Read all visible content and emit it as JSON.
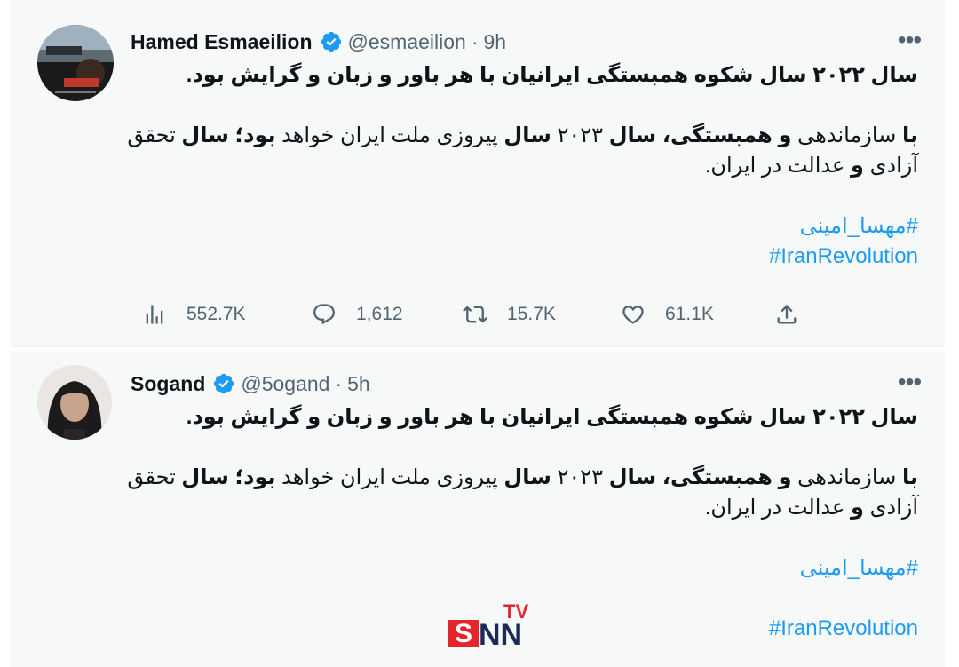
{
  "tweets": [
    {
      "name": "Hamed Esmaeilion",
      "handle": "@esmaeilion",
      "separator": "·",
      "time": "9h",
      "line1": "سال ۲۰۲۲ سال شکوه همبستگی ایرانیان با هر باور و زبان و گرایش بود.",
      "p2": {
        "w1": "با",
        "t1": " سازماندهی ",
        "w2": "و همبستگی،",
        "t2": " ",
        "w3": "سال",
        "t3": " ۲۰۲۳ ",
        "w4": "سال",
        "t4": " پیروزی ملت ایران خواهد ",
        "w5": "بود؛ سال",
        "t5": " تحقق"
      },
      "p3": {
        "t1": "آزادی ",
        "w1": "و",
        "t2": " عدالت در ایران."
      },
      "hashtag1": "#مهسا_امینی",
      "hashtag2": "#IranRevolution",
      "views": "552.7K",
      "replies": "1,612",
      "retweets": "15.7K",
      "likes": "61.1K"
    },
    {
      "name": "Sogand",
      "handle": "@5ogand",
      "separator": "·",
      "time": "5h",
      "line1": "سال ۲۰۲۲ سال شکوه همبستگی ایرانیان با هر باور و زبان و گرایش بود.",
      "p2": {
        "w1": "با",
        "t1": " سازماندهی ",
        "w2": "و همبستگی،",
        "t2": " ",
        "w3": "سال",
        "t3": " ۲۰۲۳ ",
        "w4": "سال",
        "t4": " پیروزی ملت ایران خواهد ",
        "w5": "بود؛ سال",
        "t5": " تحقق"
      },
      "p3": {
        "t1": "آزادی ",
        "w1": "و",
        "t2": " عدالت در ایران."
      },
      "hashtag1": "#مهسا_امینی",
      "hashtag2": "#IranRevolution"
    }
  ],
  "more_label": "•••",
  "watermark": {
    "s": "S",
    "nn": "NN",
    "tv": "TV"
  },
  "colors": {
    "accent": "#1d9bf0",
    "muted": "#536471",
    "text": "#0f1419",
    "background": "#f7f9f9",
    "watermark_red": "#e3262d",
    "watermark_navy": "#1c2a5a"
  },
  "icons": [
    "verified-badge-icon",
    "views-icon",
    "reply-icon",
    "retweet-icon",
    "like-icon",
    "share-icon",
    "more-icon"
  ]
}
